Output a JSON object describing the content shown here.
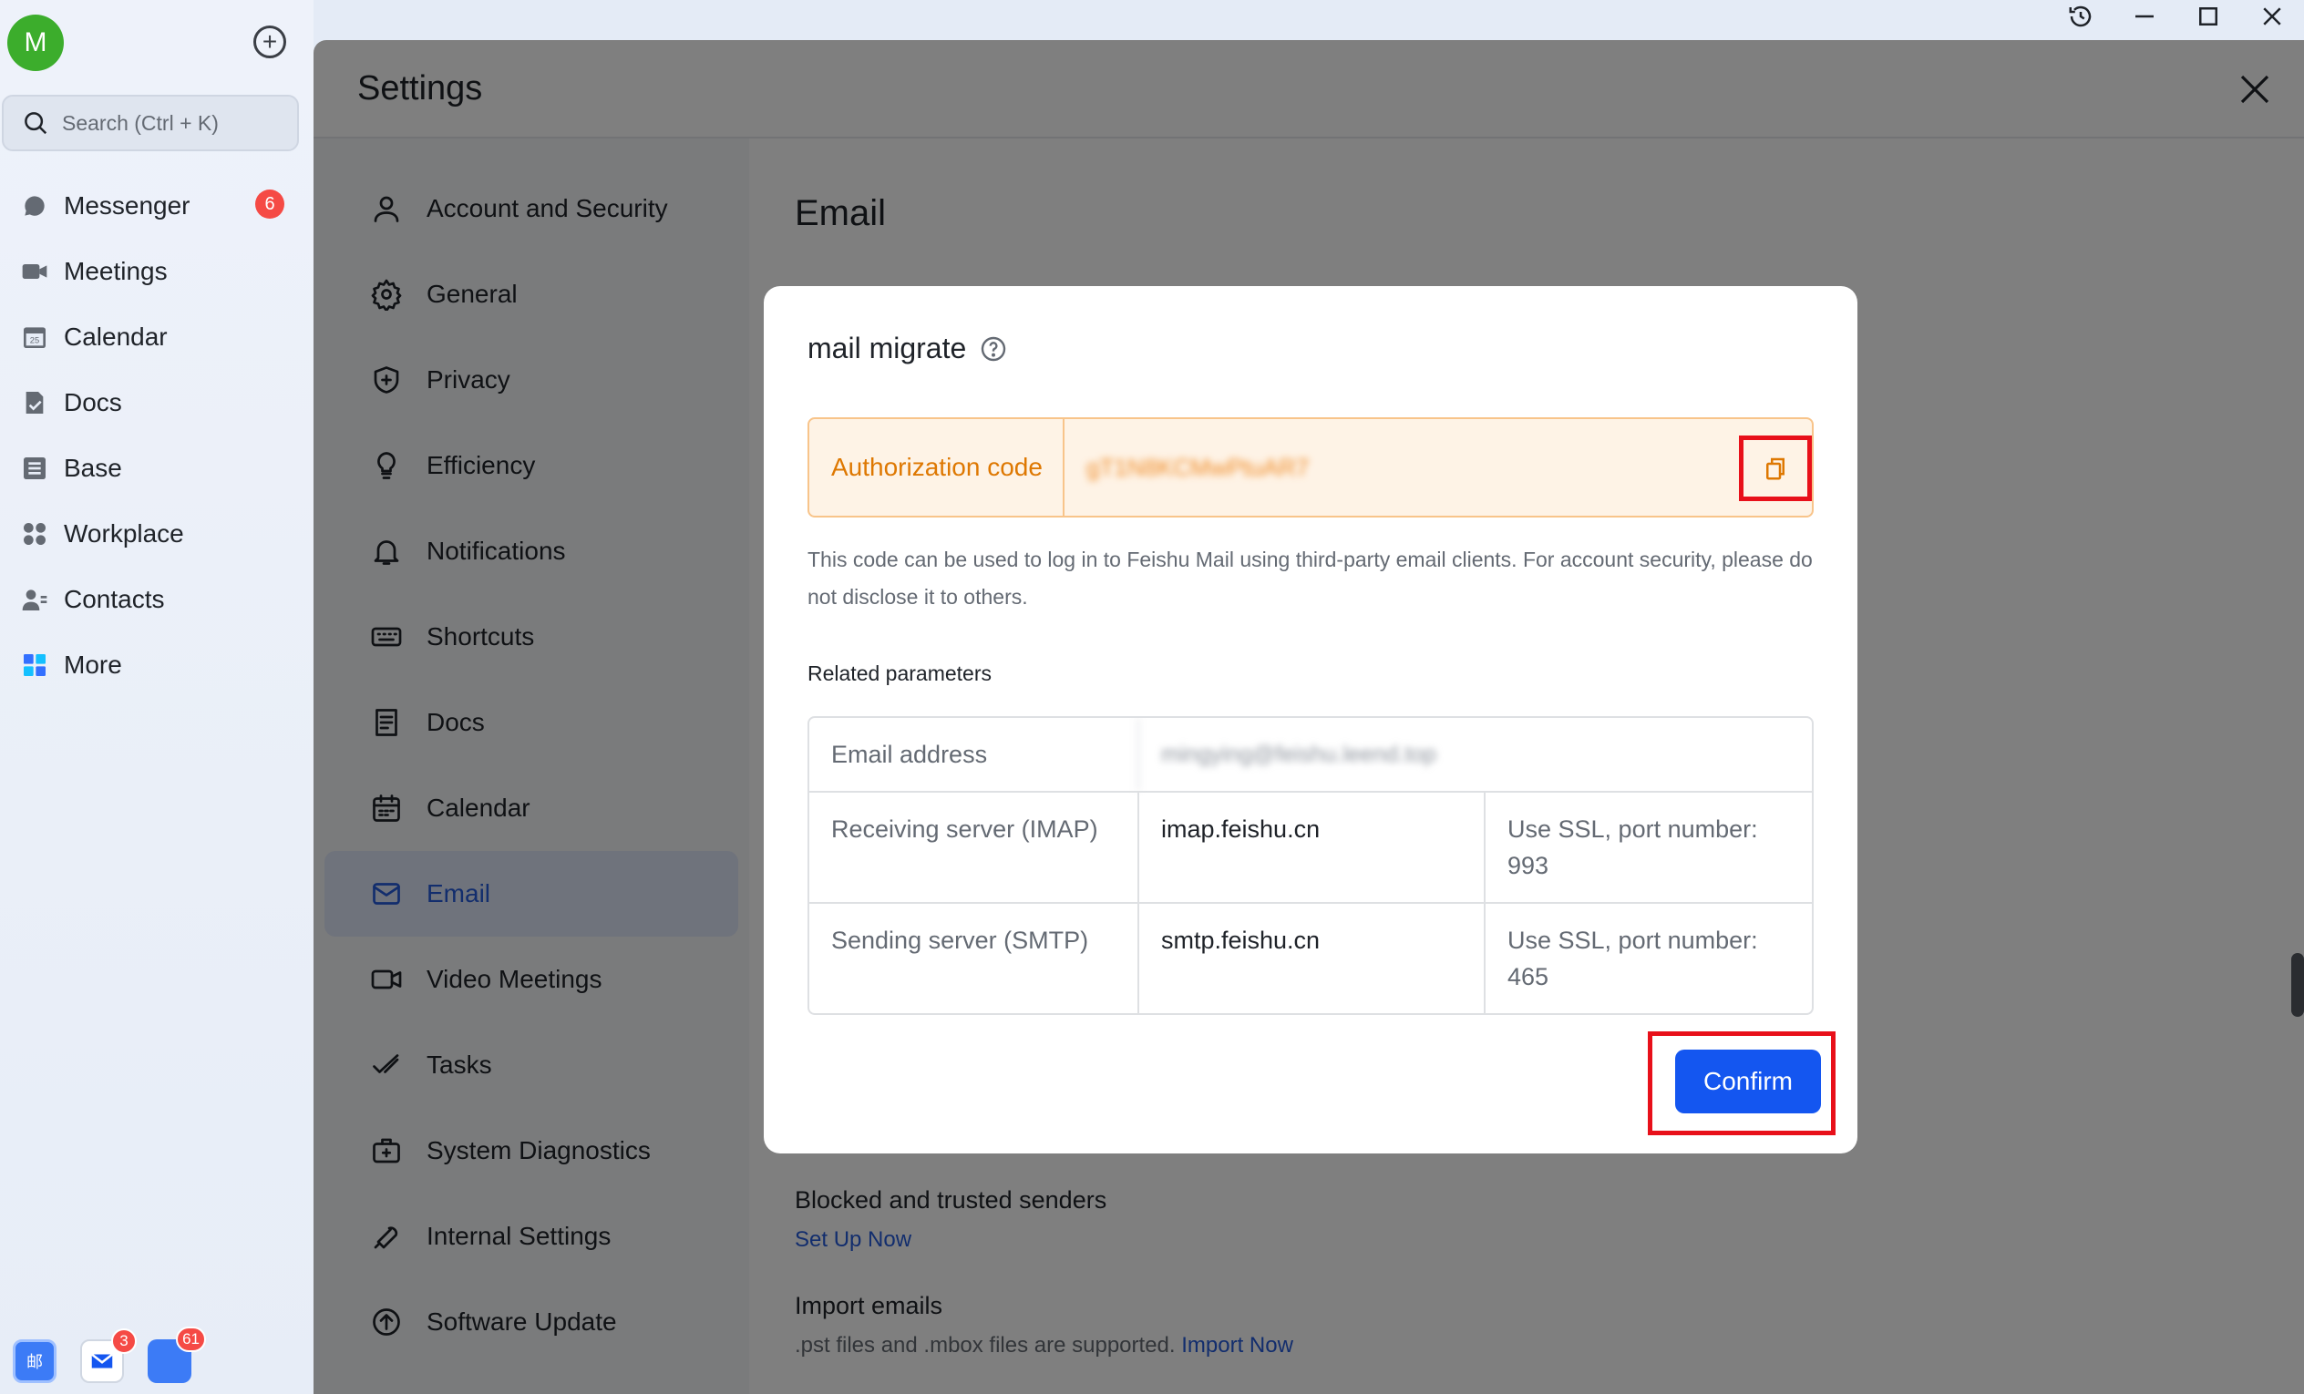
{
  "user": {
    "avatar_initial": "M"
  },
  "rail": {
    "search_placeholder": "Search (Ctrl + K)",
    "items": [
      {
        "label": "Messenger",
        "icon": "chat-icon",
        "badge": "6"
      },
      {
        "label": "Meetings",
        "icon": "video-icon"
      },
      {
        "label": "Calendar",
        "icon": "calendar-icon"
      },
      {
        "label": "Docs",
        "icon": "docs-icon"
      },
      {
        "label": "Base",
        "icon": "base-icon"
      },
      {
        "label": "Workplace",
        "icon": "workplace-icon"
      },
      {
        "label": "Contacts",
        "icon": "contacts-icon"
      },
      {
        "label": "More",
        "icon": "more-apps-icon"
      }
    ],
    "dock": [
      {
        "name": "app-a",
        "badge": ""
      },
      {
        "name": "mail-app",
        "badge": "3"
      },
      {
        "name": "app-c",
        "badge": "61"
      }
    ]
  },
  "settings": {
    "title": "Settings",
    "menu": [
      {
        "label": "Account and Security",
        "icon": "user-icon"
      },
      {
        "label": "General",
        "icon": "gear-icon"
      },
      {
        "label": "Privacy",
        "icon": "shield-icon"
      },
      {
        "label": "Efficiency",
        "icon": "bulb-icon"
      },
      {
        "label": "Notifications",
        "icon": "bell-icon"
      },
      {
        "label": "Shortcuts",
        "icon": "keyboard-icon"
      },
      {
        "label": "Docs",
        "icon": "document-icon"
      },
      {
        "label": "Calendar",
        "icon": "calendar-icon"
      },
      {
        "label": "Email",
        "icon": "mail-icon",
        "active": true
      },
      {
        "label": "Video Meetings",
        "icon": "video-icon"
      },
      {
        "label": "Tasks",
        "icon": "check-icon"
      },
      {
        "label": "System Diagnostics",
        "icon": "toolbox-icon"
      },
      {
        "label": "Internal Settings",
        "icon": "wrench-icon"
      },
      {
        "label": "Software Update",
        "icon": "upload-icon"
      }
    ],
    "main": {
      "title": "Email",
      "blocked_title": "Blocked and trusted senders",
      "blocked_link": "Set Up Now",
      "import_title": "Import emails",
      "import_desc": ".pst files and .mbox files are supported.",
      "import_link": "Import Now"
    }
  },
  "modal": {
    "title": "mail migrate",
    "auth_label": "Authorization code",
    "auth_value": "gT1N8KCMwPtuAR7",
    "auth_note": "This code can be used to log in to Feishu Mail using third-party email clients. For account security, please do not disclose it to others.",
    "related_title": "Related parameters",
    "params": {
      "email_label": "Email address",
      "email_value": "mingying@feishu.leend.top",
      "imap_label": "Receiving server (IMAP)",
      "imap_host": "imap.feishu.cn",
      "imap_note": "Use SSL, port number: 993",
      "smtp_label": "Sending server (SMTP)",
      "smtp_host": "smtp.feishu.cn",
      "smtp_note": "Use SSL, port number: 465"
    },
    "confirm_label": "Confirm"
  },
  "colors": {
    "accent": "#1456f0",
    "highlight_box": "#e8101a",
    "auth_bg": "#fef3e6",
    "auth_text": "#de7802",
    "badge": "#f54a45"
  }
}
